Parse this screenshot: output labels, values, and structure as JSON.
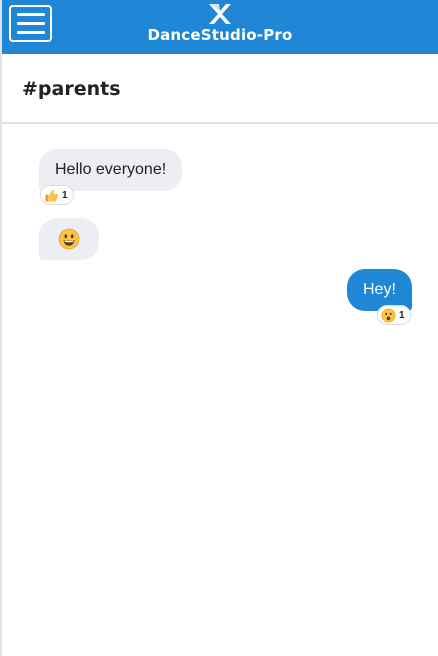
{
  "header": {
    "brand_name": "DanceStudio-Pro",
    "menu_icon": "hamburger-menu-icon",
    "logo_icon": "dancestudio-logo-icon",
    "background_color": "#1f87d6"
  },
  "channel": {
    "title": "#parents"
  },
  "messages": [
    {
      "direction": "incoming",
      "text": "Hello everyone!",
      "reaction": {
        "emoji": "thumbs-up",
        "count": "1"
      }
    },
    {
      "direction": "incoming",
      "emoji": "grinning-face"
    },
    {
      "direction": "outgoing",
      "text": "Hey!",
      "reaction": {
        "emoji": "hushed-face",
        "count": "1"
      }
    }
  ],
  "colors": {
    "incoming_bubble": "#eceef3",
    "outgoing_bubble": "#1f87d6"
  }
}
